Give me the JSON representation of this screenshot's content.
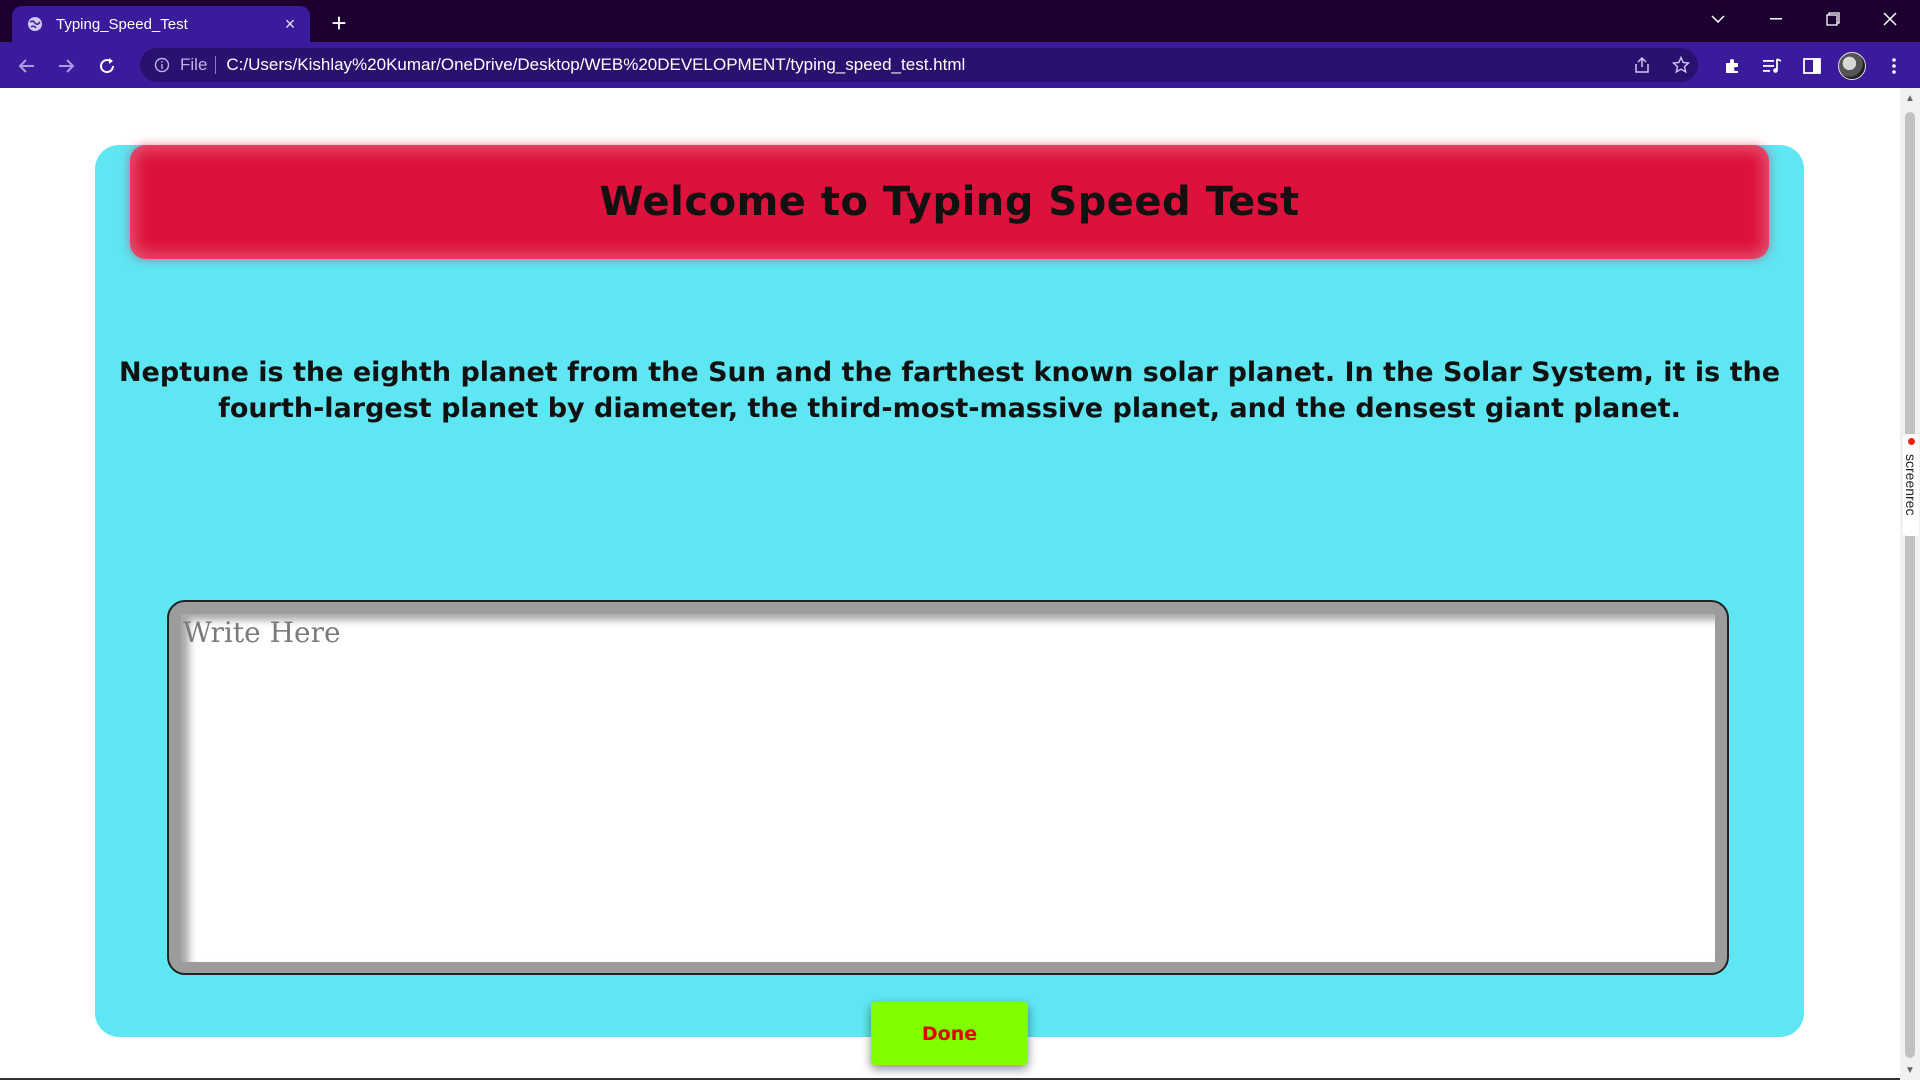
{
  "browser": {
    "tab_title": "Typing_Speed_Test",
    "new_tab_symbol": "+",
    "close_symbol": "×",
    "scheme_label": "File",
    "url": "C:/Users/Kishlay%20Kumar/OneDrive/Desktop/WEB%20DEVELOPMENT/typing_speed_test.html",
    "colors": {
      "titlebar": "#1c0030",
      "toolbar": "#3b1a9c",
      "omnibox": "#2a1170"
    }
  },
  "page": {
    "heading": "Welcome to Typing Speed Test",
    "passage": "Neptune is the eighth planet from the Sun and the farthest known solar planet. In the Solar System, it is the fourth-largest planet by diameter, the third-most-massive planet, and the densest giant planet.",
    "input_placeholder": "Write Here",
    "input_value": "",
    "done_label": "Done",
    "colors": {
      "card": "#5ee6f2",
      "banner": "#dc123c",
      "button": "#7fff00",
      "button_text": "#e00000"
    }
  },
  "overlay": {
    "screenrec_label": "screenrec"
  }
}
